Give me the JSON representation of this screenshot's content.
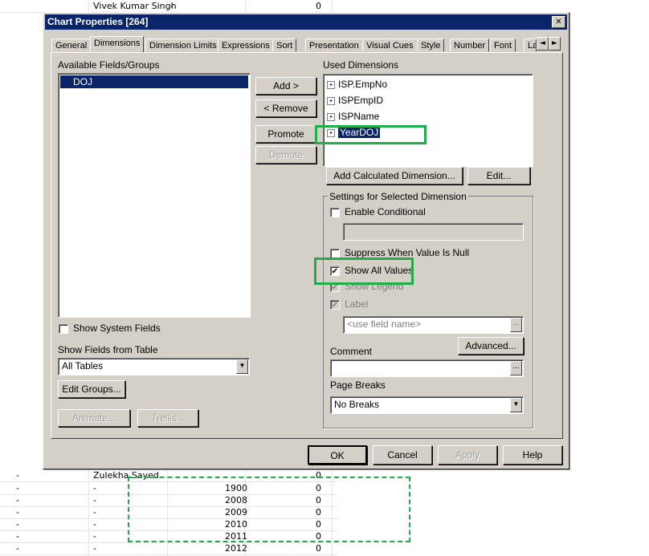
{
  "sheet": {
    "top_row": {
      "name": "Vivek Kumar Singh",
      "dash": "-",
      "value": "0"
    },
    "left_dash": "-",
    "bottom_name": "Zulekha Sayed",
    "bottom_rows": [
      {
        "a": "-",
        "b": "-",
        "year": "",
        "value": "0"
      },
      {
        "a": "-",
        "b": "-",
        "year": "1900",
        "value": "0"
      },
      {
        "a": "-",
        "b": "-",
        "year": "2008",
        "value": "0"
      },
      {
        "a": "-",
        "b": "-",
        "year": "2009",
        "value": "0"
      },
      {
        "a": "-",
        "b": "-",
        "year": "2010",
        "value": "0"
      },
      {
        "a": "-",
        "b": "-",
        "year": "2011",
        "value": "0"
      },
      {
        "a": "-",
        "b": "-",
        "year": "2012",
        "value": "0"
      }
    ]
  },
  "dialog": {
    "title": "Chart Properties [264]",
    "close_glyph": "✕",
    "tabs": [
      "General",
      "Dimensions",
      "Dimension Limits",
      "Expressions",
      "Sort",
      "Presentation",
      "Visual Cues",
      "Style",
      "Number",
      "Font",
      "La"
    ],
    "tab_scroll_left": "◄",
    "tab_scroll_right": "►",
    "available_label": "Available Fields/Groups",
    "available_fields": [
      "DOJ"
    ],
    "add_button": "Add >",
    "remove_button": "< Remove",
    "promote_button": "Promote",
    "demote_button": "Demote",
    "used_label": "Used Dimensions",
    "used_dimensions": [
      "ISP.EmpNo",
      "ISPEmpID",
      "ISPName",
      "YearDOJ"
    ],
    "add_calc_button": "Add Calculated Dimension...",
    "edit_button": "Edit...",
    "settings_title": "Settings for Selected Dimension",
    "enable_conditional": "Enable Conditional",
    "suppress_null": "Suppress When Value Is Null",
    "show_all_values": "Show All Values",
    "show_legend": "Show Legend",
    "label": "Label",
    "label_placeholder": "<use field name>",
    "ellipsis": "...",
    "advanced_button": "Advanced...",
    "comment_label": "Comment",
    "page_breaks_label": "Page Breaks",
    "page_breaks_value": "No Breaks",
    "show_system_fields": "Show System Fields",
    "show_fields_label": "Show Fields from Table",
    "show_fields_value": "All Tables",
    "edit_groups_button": "Edit Groups...",
    "animate_button": "Animate...",
    "trellis_button": "Trellis...",
    "ok_button": "OK",
    "cancel_button": "Cancel",
    "apply_button": "Apply",
    "help_button": "Help",
    "check_mark": "✔",
    "dropdown_glyph": "▼"
  },
  "colors": {
    "highlight": "#1fae4a",
    "selection": "#0a246a",
    "dialog_bg": "#d4d0c8"
  }
}
